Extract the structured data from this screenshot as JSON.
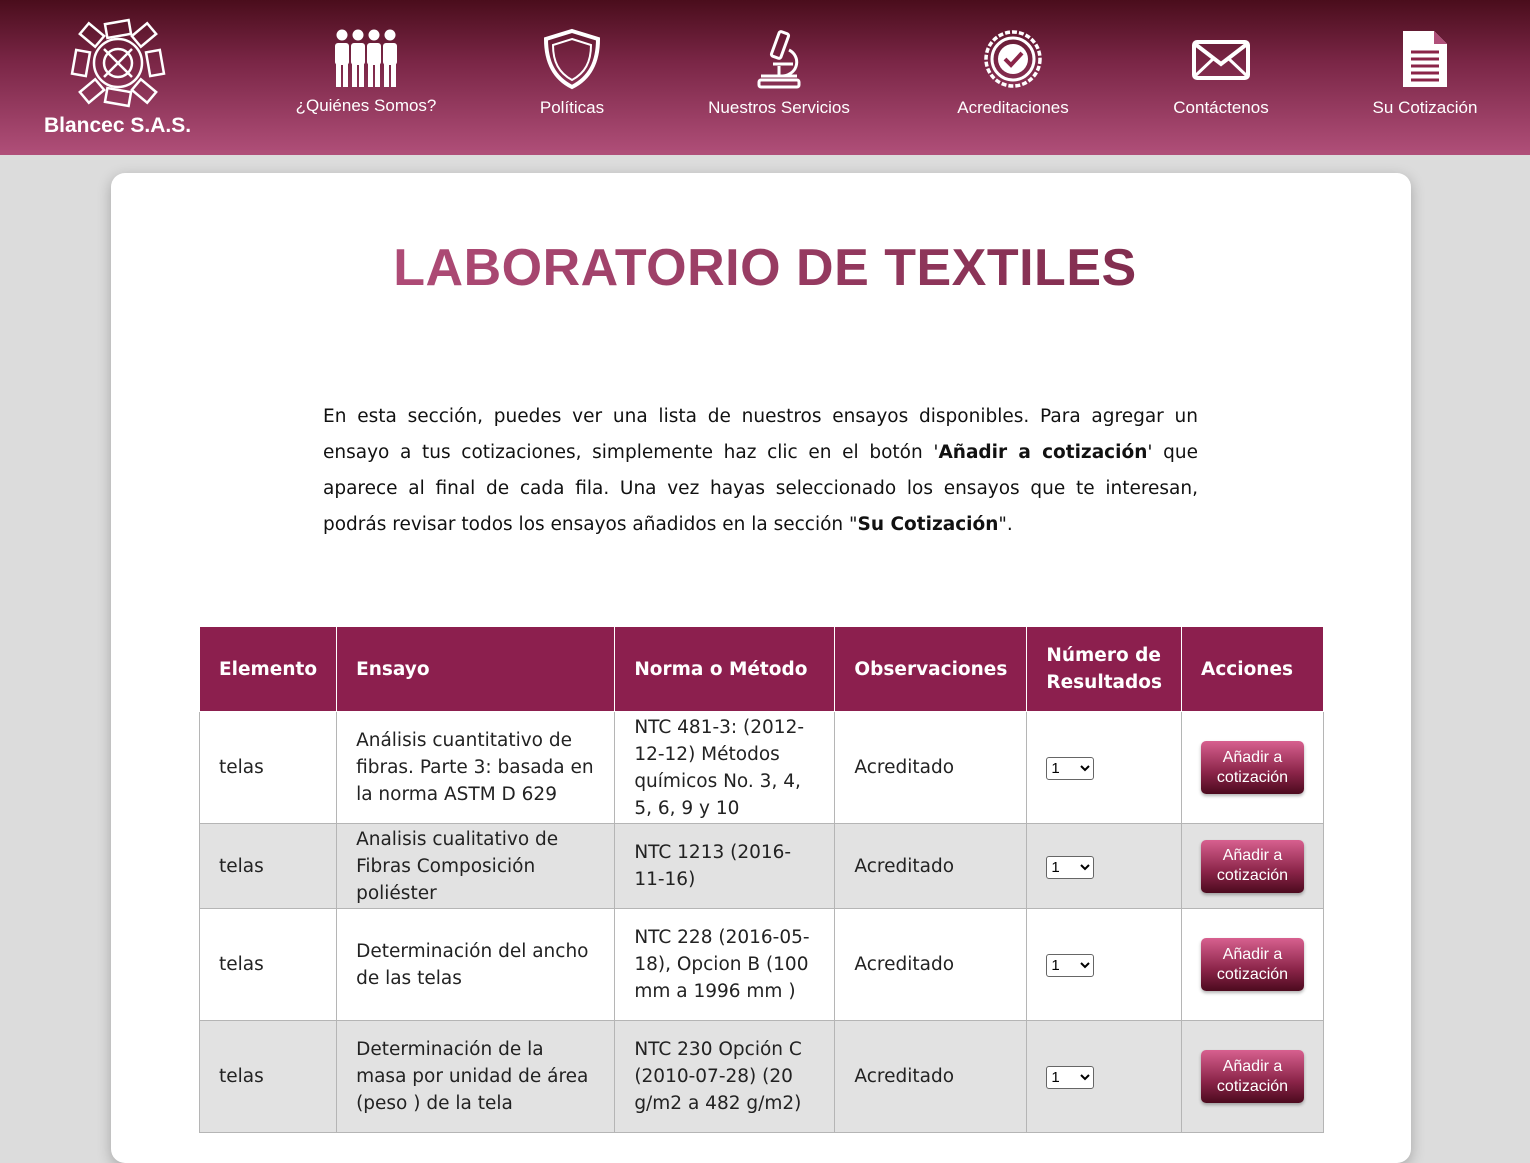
{
  "header": {
    "brand": "Blancec S.A.S.",
    "nav": [
      {
        "label": "¿Quiénes Somos?",
        "icon": "people-icon"
      },
      {
        "label": "Políticas",
        "icon": "shield-icon"
      },
      {
        "label": "Nuestros Servicios",
        "icon": "microscope-icon"
      },
      {
        "label": "Acreditaciones",
        "icon": "check-seal-icon"
      },
      {
        "label": "Contáctenos",
        "icon": "envelope-icon"
      },
      {
        "label": "Su Cotización",
        "icon": "document-icon"
      }
    ]
  },
  "main": {
    "title": "LABORATORIO DE TEXTILES",
    "intro": {
      "p1": "En esta sección, puedes ver una lista de nuestros ensayos disponibles. Para agregar un ensayo a tus cotizaciones, simplemente haz clic en el botón '",
      "b1": "Añadir a cotización",
      "p2": "' que aparece al final de cada fila. Una vez hayas seleccionado los ensayos que te interesan, podrás revisar todos los ensayos añadidos en la sección \"",
      "b2": "Su Cotización",
      "p3": "\"."
    }
  },
  "table": {
    "headers": [
      "Elemento",
      "Ensayo",
      "Norma o Método",
      "Observaciones",
      "Número de Resultados",
      "Acciones"
    ],
    "rows": [
      {
        "elemento": "telas",
        "ensayo": "Análisis cuantitativo de fibras. Parte 3: basada en la norma ASTM D 629",
        "norma": "NTC 481-3: (2012-12-12) Métodos químicos No. 3, 4, 5, 6, 9 y 10",
        "observaciones": "Acreditado",
        "resultados": "1",
        "accion": "Añadir a cotización"
      },
      {
        "elemento": "telas",
        "ensayo": "Analisis cualitativo de Fibras Composición poliéster",
        "norma": "NTC 1213 (2016-11-16)",
        "observaciones": "Acreditado",
        "resultados": "1",
        "accion": "Añadir a cotización"
      },
      {
        "elemento": "telas",
        "ensayo": "Determinación del ancho de las telas",
        "norma": "NTC 228 (2016-05-18), Opcion B (100 mm a 1996 mm )",
        "observaciones": "Acreditado",
        "resultados": "1",
        "accion": "Añadir a cotización"
      },
      {
        "elemento": "telas",
        "ensayo": "Determinación de la masa por unidad de área (peso ) de la tela",
        "norma": "NTC 230 Opción C (2010-07-28) (20 g/m2 a 482 g/m2)",
        "observaciones": "Acreditado",
        "resultados": "1",
        "accion": "Añadir a cotización"
      }
    ]
  }
}
